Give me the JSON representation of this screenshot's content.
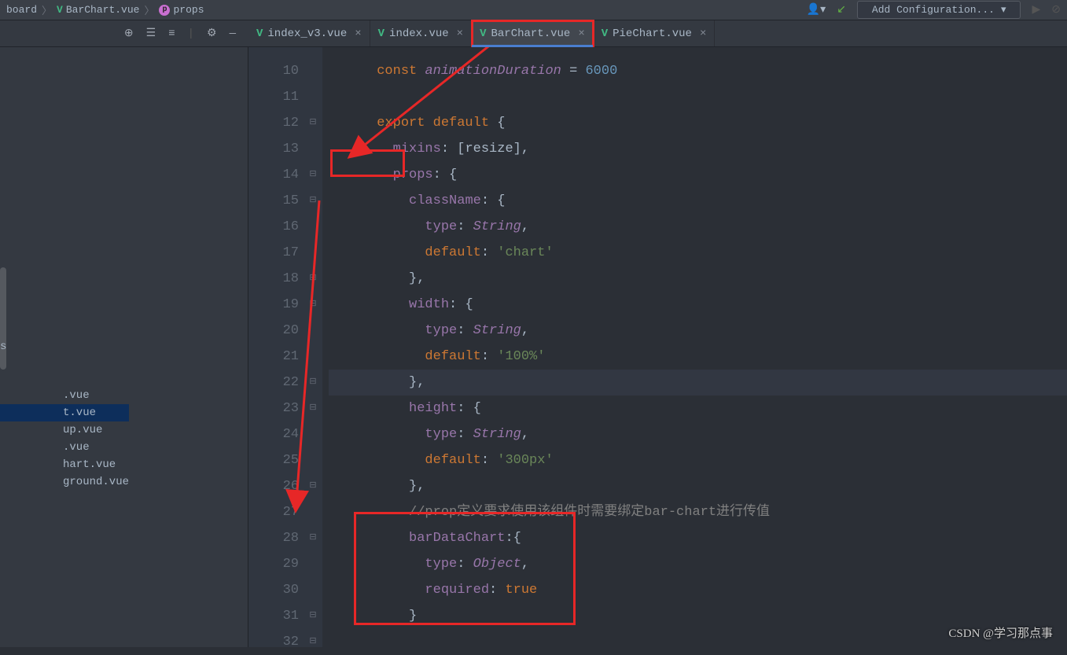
{
  "breadcrumb": {
    "item1": "board",
    "item2": "BarChart.vue",
    "item3": "props"
  },
  "topbar": {
    "addConfig": "Add Configuration..."
  },
  "tabs": [
    {
      "label": "index_v3.vue",
      "active": false
    },
    {
      "label": "index.vue",
      "active": false
    },
    {
      "label": "BarChart.vue",
      "active": true
    },
    {
      "label": "PieChart.vue",
      "active": false
    }
  ],
  "sidebar": {
    "items": [
      {
        "label": "s"
      },
      {
        "label": ".vue"
      },
      {
        "label": "t.vue"
      },
      {
        "label": "up.vue"
      },
      {
        "label": ".vue"
      },
      {
        "label": "hart.vue"
      },
      {
        "label": "ground.vue"
      }
    ],
    "selectedIndex": 2
  },
  "code": {
    "startLine": 10,
    "lines": [
      {
        "n": 10,
        "fold": "",
        "ind": 6,
        "tokens": [
          [
            "kw",
            "const "
          ],
          [
            "it",
            "animationDuration"
          ],
          [
            "pun",
            " = "
          ],
          [
            "num",
            "6000"
          ]
        ]
      },
      {
        "n": 11,
        "fold": "",
        "ind": 0,
        "tokens": []
      },
      {
        "n": 12,
        "fold": "⊟",
        "ind": 6,
        "tokens": [
          [
            "kw",
            "export default "
          ],
          [
            "pun",
            "{"
          ]
        ]
      },
      {
        "n": 13,
        "fold": "",
        "ind": 8,
        "tokens": [
          [
            "pur",
            "mixins"
          ],
          [
            "pun",
            ": ["
          ],
          [
            "id",
            "resize"
          ],
          [
            "pun",
            "],"
          ]
        ]
      },
      {
        "n": 14,
        "fold": "⊟",
        "ind": 8,
        "tokens": [
          [
            "pur",
            "props"
          ],
          [
            "pun",
            ": {"
          ]
        ]
      },
      {
        "n": 15,
        "fold": "⊟",
        "ind": 10,
        "tokens": [
          [
            "pur",
            "className"
          ],
          [
            "pun",
            ": {"
          ]
        ]
      },
      {
        "n": 16,
        "fold": "",
        "ind": 12,
        "tokens": [
          [
            "pur",
            "type"
          ],
          [
            "pun",
            ": "
          ],
          [
            "it",
            "String"
          ],
          [
            "pun",
            ","
          ]
        ]
      },
      {
        "n": 17,
        "fold": "",
        "ind": 12,
        "tokens": [
          [
            "kw",
            "default"
          ],
          [
            "pun",
            ": "
          ],
          [
            "str",
            "'chart'"
          ]
        ]
      },
      {
        "n": 18,
        "fold": "⊟",
        "ind": 10,
        "tokens": [
          [
            "pun",
            "},"
          ]
        ]
      },
      {
        "n": 19,
        "fold": "⊟",
        "ind": 10,
        "tokens": [
          [
            "pur",
            "width"
          ],
          [
            "pun",
            ": {"
          ]
        ]
      },
      {
        "n": 20,
        "fold": "",
        "ind": 12,
        "tokens": [
          [
            "pur",
            "type"
          ],
          [
            "pun",
            ": "
          ],
          [
            "it",
            "String"
          ],
          [
            "pun",
            ","
          ]
        ]
      },
      {
        "n": 21,
        "fold": "",
        "ind": 12,
        "tokens": [
          [
            "kw",
            "default"
          ],
          [
            "pun",
            ": "
          ],
          [
            "str",
            "'100%'"
          ]
        ]
      },
      {
        "n": 22,
        "fold": "⊟",
        "ind": 10,
        "tokens": [
          [
            "pun",
            "},"
          ]
        ],
        "hl": true
      },
      {
        "n": 23,
        "fold": "⊟",
        "ind": 10,
        "tokens": [
          [
            "pur",
            "height"
          ],
          [
            "pun",
            ": {"
          ]
        ]
      },
      {
        "n": 24,
        "fold": "",
        "ind": 12,
        "tokens": [
          [
            "pur",
            "type"
          ],
          [
            "pun",
            ": "
          ],
          [
            "it",
            "String"
          ],
          [
            "pun",
            ","
          ]
        ]
      },
      {
        "n": 25,
        "fold": "",
        "ind": 12,
        "tokens": [
          [
            "kw",
            "default"
          ],
          [
            "pun",
            ": "
          ],
          [
            "str",
            "'300px'"
          ]
        ]
      },
      {
        "n": 26,
        "fold": "⊟",
        "ind": 10,
        "tokens": [
          [
            "pun",
            "},"
          ]
        ]
      },
      {
        "n": 27,
        "fold": "",
        "ind": 10,
        "tokens": [
          [
            "com",
            "//prop定义要求使用该组件时需要绑定bar-chart进行传值"
          ]
        ]
      },
      {
        "n": 28,
        "fold": "⊟",
        "ind": 10,
        "tokens": [
          [
            "pur",
            "barDataChart"
          ],
          [
            "pun",
            ":{"
          ]
        ]
      },
      {
        "n": 29,
        "fold": "",
        "ind": 12,
        "tokens": [
          [
            "pur",
            "type"
          ],
          [
            "pun",
            ": "
          ],
          [
            "it",
            "Object"
          ],
          [
            "pun",
            ","
          ]
        ]
      },
      {
        "n": 30,
        "fold": "",
        "ind": 12,
        "tokens": [
          [
            "pur",
            "required"
          ],
          [
            "pun",
            ": "
          ],
          [
            "kw",
            "true"
          ]
        ]
      },
      {
        "n": 31,
        "fold": "⊟",
        "ind": 10,
        "tokens": [
          [
            "pun",
            "}"
          ]
        ]
      },
      {
        "n": 32,
        "fold": "⊟",
        "ind": 8,
        "tokens": [
          [
            "pun",
            ""
          ]
        ]
      }
    ]
  },
  "watermark": "CSDN @学习那点事"
}
